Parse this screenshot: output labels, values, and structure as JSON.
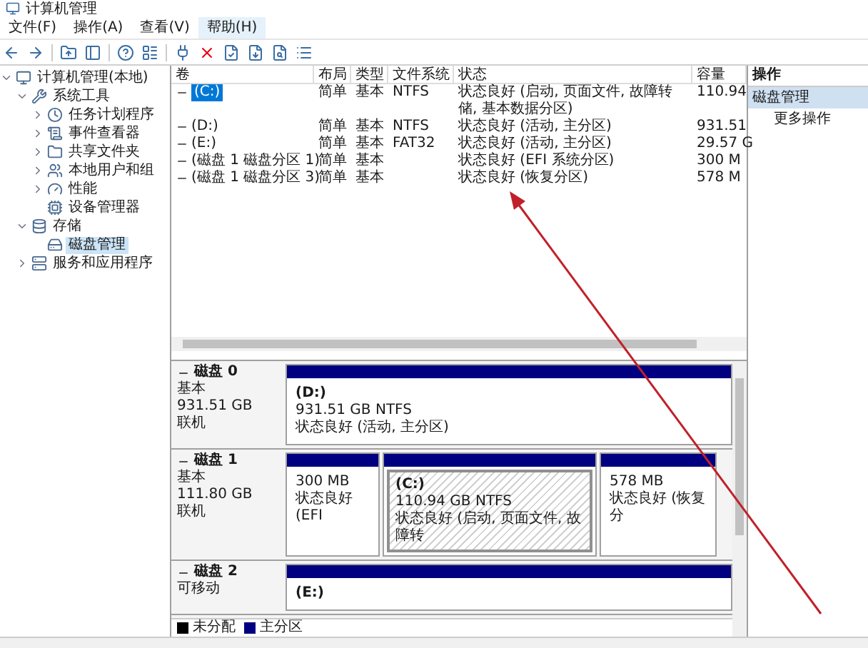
{
  "window": {
    "title": "计算机管理"
  },
  "menu": [
    {
      "label": "文件(F)",
      "selected": false
    },
    {
      "label": "操作(A)",
      "selected": false
    },
    {
      "label": "查看(V)",
      "selected": false
    },
    {
      "label": "帮助(H)",
      "selected": true
    }
  ],
  "tree": [
    {
      "label": "计算机管理(本地)",
      "expanded": true,
      "selected": false,
      "children": [
        {
          "label": "系统工具",
          "expanded": true,
          "selected": false,
          "children": [
            {
              "label": "任务计划程序",
              "expanded": false,
              "selected": false
            },
            {
              "label": "事件查看器",
              "expanded": false,
              "selected": false
            },
            {
              "label": "共享文件夹",
              "expanded": false,
              "selected": false
            },
            {
              "label": "本地用户和组",
              "expanded": false,
              "selected": false
            },
            {
              "label": "性能",
              "expanded": false,
              "selected": false
            },
            {
              "label": "设备管理器",
              "selected": false
            }
          ]
        },
        {
          "label": "存储",
          "expanded": true,
          "selected": false,
          "children": [
            {
              "label": "磁盘管理",
              "selected": true
            }
          ]
        },
        {
          "label": "服务和应用程序",
          "expanded": false,
          "selected": false
        }
      ]
    }
  ],
  "volumes": {
    "columns": [
      "卷",
      "布局",
      "类型",
      "文件系统",
      "状态",
      "容量"
    ],
    "rows": [
      {
        "selected": true,
        "cells": [
          "(C:)",
          "简单",
          "基本",
          "NTFS",
          "状态良好 (启动, 页面文件, 故障转储, 基本数据分区)",
          "110.94"
        ]
      },
      {
        "selected": false,
        "cells": [
          "(D:)",
          "简单",
          "基本",
          "NTFS",
          "状态良好 (活动, 主分区)",
          "931.51"
        ]
      },
      {
        "selected": false,
        "cells": [
          "(E:)",
          "简单",
          "基本",
          "FAT32",
          "状态良好 (活动, 主分区)",
          "29.57 G"
        ]
      },
      {
        "selected": false,
        "cells": [
          "(磁盘 1 磁盘分区 1)",
          "简单",
          "基本",
          "",
          "状态良好 (EFI 系统分区)",
          "300 M"
        ]
      },
      {
        "selected": false,
        "cells": [
          "(磁盘 1 磁盘分区 3)",
          "简单",
          "基本",
          "",
          "状态良好 (恢复分区)",
          "578 M"
        ]
      }
    ]
  },
  "disks": [
    {
      "name": "磁盘 0",
      "type": "基本",
      "size": "931.51 GB",
      "state": "联机",
      "partitions": [
        {
          "kind": "primary",
          "selected": false,
          "name": "(D:)",
          "size": "931.51 GB NTFS",
          "status": "状态良好 (活动, 主分区)"
        }
      ]
    },
    {
      "name": "磁盘 1",
      "type": "基本",
      "size": "111.80 GB",
      "state": "联机",
      "partitions": [
        {
          "kind": "primary",
          "selected": false,
          "size": "300 MB",
          "status": "状态良好 (EFI"
        },
        {
          "kind": "primary",
          "selected": true,
          "name": "(C:)",
          "size": "110.94 GB NTFS",
          "status": "状态良好 (启动, 页面文件, 故障转"
        },
        {
          "kind": "primary",
          "selected": false,
          "size": "578 MB",
          "status": "状态良好 (恢复分"
        }
      ]
    },
    {
      "name": "磁盘 2",
      "type": "可移动",
      "partitions": [
        {
          "kind": "primary",
          "selected": false,
          "name": "(E:)"
        }
      ]
    }
  ],
  "legend": [
    {
      "label": "未分配",
      "color": "#000000"
    },
    {
      "label": "主分区",
      "color": "#000080"
    }
  ],
  "actions": {
    "header": "操作",
    "items": [
      {
        "kind": "group",
        "label": "磁盘管理",
        "selected": true
      },
      {
        "kind": "item",
        "label": "更多操作",
        "selected": false
      }
    ]
  }
}
